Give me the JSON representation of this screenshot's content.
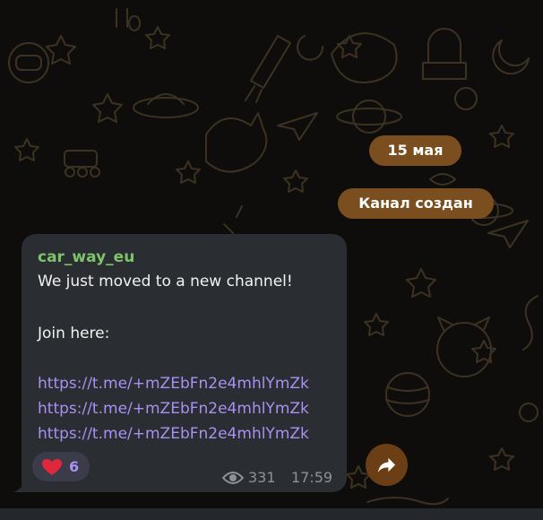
{
  "chat": {
    "date_pill": "15 мая",
    "service_message": "Канал создан"
  },
  "message": {
    "sender": "car_way_eu",
    "line1": "We just moved to a new channel!",
    "line2": "Join here:",
    "links": [
      "https://t.me/+mZEbFn2e4mhlYmZk",
      "https://t.me/+mZEbFn2e4mhlYmZk",
      "https://t.me/+mZEbFn2e4mhlYmZk"
    ],
    "reaction": {
      "icon": "heart-icon",
      "count": "6"
    },
    "views": "331",
    "time": "17:59"
  },
  "colors": {
    "background": "#0e0d0b",
    "pill": "#7a4e1f",
    "bubble": "#2a2d31",
    "sender": "#7ec36a",
    "link": "#a990f3",
    "heart": "#e0283a"
  },
  "icons": [
    "eye-icon",
    "share-icon",
    "heart-icon"
  ]
}
